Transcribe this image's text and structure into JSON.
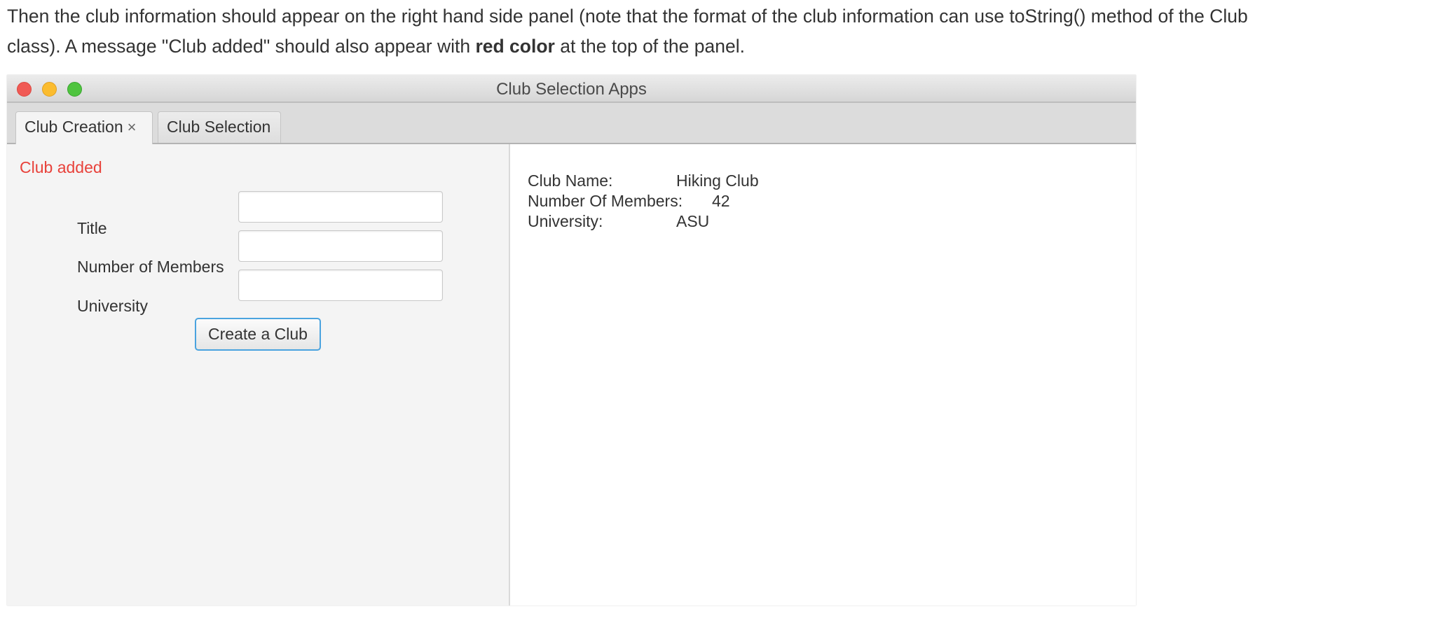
{
  "instructions": {
    "line1": "Then the club information should appear on the right hand side panel (note that the format of the club information can use toString() method of the Club",
    "line2_prefix": "class). A message \"Club added\" should also appear with ",
    "line2_bold": "red color",
    "line2_suffix": " at the top of the panel."
  },
  "window": {
    "title": "Club Selection Apps",
    "controls": [
      "close",
      "minimize",
      "zoom"
    ]
  },
  "tabs": [
    {
      "label": "Club Creation",
      "close_glyph": "×",
      "active": true
    },
    {
      "label": "Club Selection",
      "active": false
    }
  ],
  "form": {
    "status_message": "Club added",
    "status_color": "#e8423b",
    "fields": [
      {
        "label": "Title",
        "value": ""
      },
      {
        "label": "Number of Members",
        "value": ""
      },
      {
        "label": "University",
        "value": ""
      }
    ],
    "submit_label": "Create a Club"
  },
  "club_info": {
    "rows": [
      {
        "key": "Club Name:",
        "value": "Hiking Club"
      },
      {
        "key": "Number Of Members:",
        "value": "42"
      },
      {
        "key": "University:",
        "value": "ASU"
      }
    ]
  }
}
